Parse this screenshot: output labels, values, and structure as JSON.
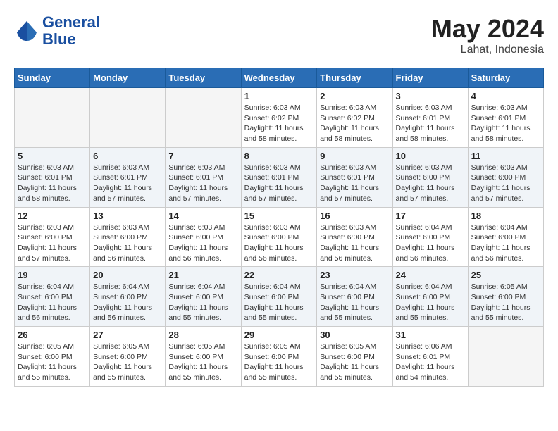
{
  "header": {
    "logo_line1": "General",
    "logo_line2": "Blue",
    "month_year": "May 2024",
    "location": "Lahat, Indonesia"
  },
  "days_of_week": [
    "Sunday",
    "Monday",
    "Tuesday",
    "Wednesday",
    "Thursday",
    "Friday",
    "Saturday"
  ],
  "weeks": [
    [
      {
        "day": "",
        "empty": true
      },
      {
        "day": "",
        "empty": true
      },
      {
        "day": "",
        "empty": true
      },
      {
        "day": "1",
        "sunrise": "6:03 AM",
        "sunset": "6:02 PM",
        "daylight": "11 hours and 58 minutes."
      },
      {
        "day": "2",
        "sunrise": "6:03 AM",
        "sunset": "6:02 PM",
        "daylight": "11 hours and 58 minutes."
      },
      {
        "day": "3",
        "sunrise": "6:03 AM",
        "sunset": "6:01 PM",
        "daylight": "11 hours and 58 minutes."
      },
      {
        "day": "4",
        "sunrise": "6:03 AM",
        "sunset": "6:01 PM",
        "daylight": "11 hours and 58 minutes."
      }
    ],
    [
      {
        "day": "5",
        "sunrise": "6:03 AM",
        "sunset": "6:01 PM",
        "daylight": "11 hours and 58 minutes."
      },
      {
        "day": "6",
        "sunrise": "6:03 AM",
        "sunset": "6:01 PM",
        "daylight": "11 hours and 57 minutes."
      },
      {
        "day": "7",
        "sunrise": "6:03 AM",
        "sunset": "6:01 PM",
        "daylight": "11 hours and 57 minutes."
      },
      {
        "day": "8",
        "sunrise": "6:03 AM",
        "sunset": "6:01 PM",
        "daylight": "11 hours and 57 minutes."
      },
      {
        "day": "9",
        "sunrise": "6:03 AM",
        "sunset": "6:01 PM",
        "daylight": "11 hours and 57 minutes."
      },
      {
        "day": "10",
        "sunrise": "6:03 AM",
        "sunset": "6:00 PM",
        "daylight": "11 hours and 57 minutes."
      },
      {
        "day": "11",
        "sunrise": "6:03 AM",
        "sunset": "6:00 PM",
        "daylight": "11 hours and 57 minutes."
      }
    ],
    [
      {
        "day": "12",
        "sunrise": "6:03 AM",
        "sunset": "6:00 PM",
        "daylight": "11 hours and 57 minutes."
      },
      {
        "day": "13",
        "sunrise": "6:03 AM",
        "sunset": "6:00 PM",
        "daylight": "11 hours and 56 minutes."
      },
      {
        "day": "14",
        "sunrise": "6:03 AM",
        "sunset": "6:00 PM",
        "daylight": "11 hours and 56 minutes."
      },
      {
        "day": "15",
        "sunrise": "6:03 AM",
        "sunset": "6:00 PM",
        "daylight": "11 hours and 56 minutes."
      },
      {
        "day": "16",
        "sunrise": "6:03 AM",
        "sunset": "6:00 PM",
        "daylight": "11 hours and 56 minutes."
      },
      {
        "day": "17",
        "sunrise": "6:04 AM",
        "sunset": "6:00 PM",
        "daylight": "11 hours and 56 minutes."
      },
      {
        "day": "18",
        "sunrise": "6:04 AM",
        "sunset": "6:00 PM",
        "daylight": "11 hours and 56 minutes."
      }
    ],
    [
      {
        "day": "19",
        "sunrise": "6:04 AM",
        "sunset": "6:00 PM",
        "daylight": "11 hours and 56 minutes."
      },
      {
        "day": "20",
        "sunrise": "6:04 AM",
        "sunset": "6:00 PM",
        "daylight": "11 hours and 56 minutes."
      },
      {
        "day": "21",
        "sunrise": "6:04 AM",
        "sunset": "6:00 PM",
        "daylight": "11 hours and 55 minutes."
      },
      {
        "day": "22",
        "sunrise": "6:04 AM",
        "sunset": "6:00 PM",
        "daylight": "11 hours and 55 minutes."
      },
      {
        "day": "23",
        "sunrise": "6:04 AM",
        "sunset": "6:00 PM",
        "daylight": "11 hours and 55 minutes."
      },
      {
        "day": "24",
        "sunrise": "6:04 AM",
        "sunset": "6:00 PM",
        "daylight": "11 hours and 55 minutes."
      },
      {
        "day": "25",
        "sunrise": "6:05 AM",
        "sunset": "6:00 PM",
        "daylight": "11 hours and 55 minutes."
      }
    ],
    [
      {
        "day": "26",
        "sunrise": "6:05 AM",
        "sunset": "6:00 PM",
        "daylight": "11 hours and 55 minutes."
      },
      {
        "day": "27",
        "sunrise": "6:05 AM",
        "sunset": "6:00 PM",
        "daylight": "11 hours and 55 minutes."
      },
      {
        "day": "28",
        "sunrise": "6:05 AM",
        "sunset": "6:00 PM",
        "daylight": "11 hours and 55 minutes."
      },
      {
        "day": "29",
        "sunrise": "6:05 AM",
        "sunset": "6:00 PM",
        "daylight": "11 hours and 55 minutes."
      },
      {
        "day": "30",
        "sunrise": "6:05 AM",
        "sunset": "6:00 PM",
        "daylight": "11 hours and 55 minutes."
      },
      {
        "day": "31",
        "sunrise": "6:06 AM",
        "sunset": "6:01 PM",
        "daylight": "11 hours and 54 minutes."
      },
      {
        "day": "",
        "empty": true
      }
    ]
  ]
}
